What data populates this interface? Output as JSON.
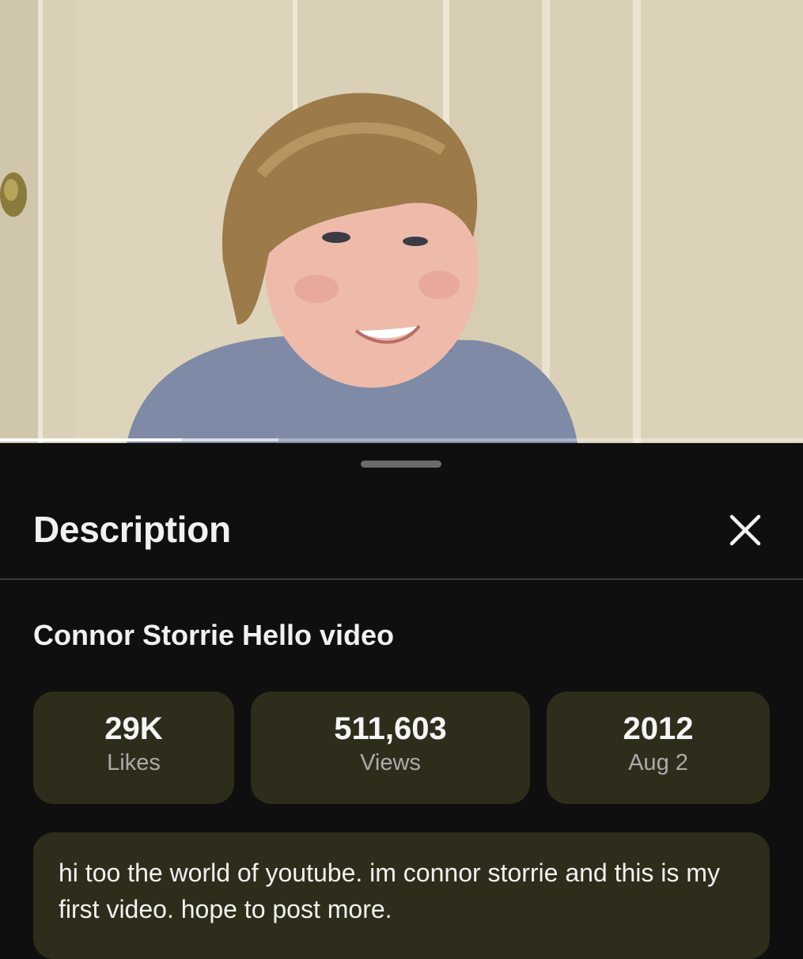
{
  "video": {
    "progress_played_fraction": 0.227,
    "progress_buffered_fraction": 0.347
  },
  "sheet": {
    "title": "Description",
    "close_icon": "close-icon"
  },
  "video_title": "Connor Storrie Hello video",
  "stats": [
    {
      "value": "29K",
      "label": "Likes"
    },
    {
      "value": "511,603",
      "label": "Views"
    },
    {
      "value": "2012",
      "label": "Aug 2"
    }
  ],
  "description": "hi too the world of youtube. im connor storrie and this is my first video. hope to post more.",
  "colors": {
    "sheet_background": "#0f0f0f",
    "card_background": "#2e2d1b",
    "text_primary": "#f1f1f1",
    "text_secondary": "#aaaaaa"
  }
}
